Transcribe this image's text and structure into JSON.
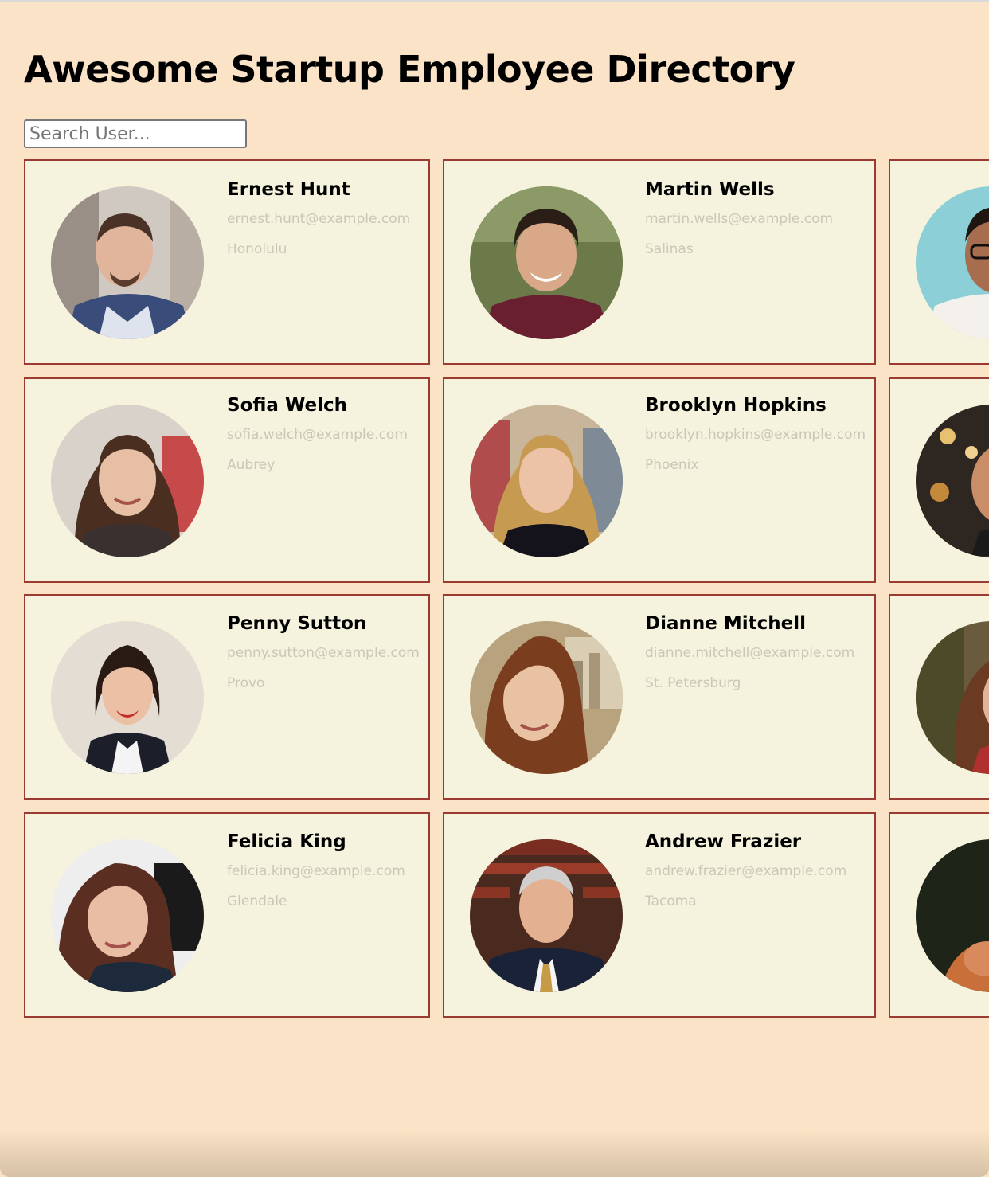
{
  "page": {
    "title": "Awesome Startup Employee Directory",
    "background": "#fae3c6"
  },
  "search": {
    "placeholder": "Search User..."
  },
  "theme": {
    "card_border": "#9b3a30",
    "card_background": "#f5f3de",
    "secondary_text": "#c9c7b8"
  },
  "employees": [
    {
      "name": "Ernest Hunt",
      "email": "ernest.hunt@example.com",
      "city": "Honolulu"
    },
    {
      "name": "Martin Wells",
      "email": "martin.wells@example.com",
      "city": "Salinas"
    },
    {
      "name": "Sofia Welch",
      "email": "sofia.welch@example.com",
      "city": "Aubrey"
    },
    {
      "name": "Brooklyn Hopkins",
      "email": "brooklyn.hopkins@example.com",
      "city": "Phoenix"
    },
    {
      "name": "Penny Sutton",
      "email": "penny.sutton@example.com",
      "city": "Provo"
    },
    {
      "name": "Dianne Mitchell",
      "email": "dianne.mitchell@example.com",
      "city": "St. Petersburg"
    },
    {
      "name": "Felicia King",
      "email": "felicia.king@example.com",
      "city": "Glendale"
    },
    {
      "name": "Andrew Frazier",
      "email": "andrew.frazier@example.com",
      "city": "Tacoma"
    }
  ]
}
